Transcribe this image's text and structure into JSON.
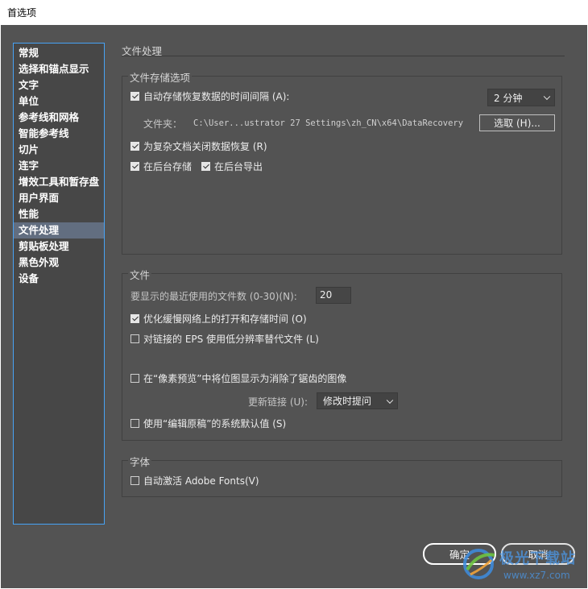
{
  "window": {
    "title": "首选项"
  },
  "sidebar": {
    "items": [
      {
        "label": "常规"
      },
      {
        "label": "选择和锚点显示"
      },
      {
        "label": "文字"
      },
      {
        "label": "单位"
      },
      {
        "label": "参考线和网格"
      },
      {
        "label": "智能参考线"
      },
      {
        "label": "切片"
      },
      {
        "label": "连字"
      },
      {
        "label": "增效工具和暂存盘"
      },
      {
        "label": "用户界面"
      },
      {
        "label": "性能"
      },
      {
        "label": "文件处理",
        "selected": true
      },
      {
        "label": "剪贴板处理"
      },
      {
        "label": "黑色外观"
      },
      {
        "label": "设备"
      }
    ]
  },
  "page": {
    "title": "文件处理"
  },
  "storage_group": {
    "title": "文件存储选项",
    "autosave_label": "自动存储恢复数据的时间间隔 (A):",
    "autosave_checked": true,
    "interval_value": "2 分钟",
    "folder_label": "文件夹：",
    "folder_path": "C:\\User...ustrator 27 Settings\\zh_CN\\x64\\DataRecovery",
    "choose_button": "选取 (H)...",
    "complex_label": "为复杂文档关闭数据恢复 (R)",
    "complex_checked": true,
    "bg_save_label": "在后台存储",
    "bg_save_checked": true,
    "bg_export_label": "在后台导出",
    "bg_export_checked": true
  },
  "files_group": {
    "title": "文件",
    "recent_label": "要显示的最近使用的文件数 (0-30)(N):",
    "recent_value": "20",
    "optimize_label": "优化缓慢网络上的打开和存储时间 (O)",
    "optimize_checked": true,
    "eps_label": "对链接的 EPS 使用低分辨率替代文件 (L)",
    "eps_checked": false,
    "pixel_preview_label": "在“像素预览”中将位图显示为消除了锯齿的图像",
    "pixel_preview_checked": false,
    "update_links_label": "更新链接 (U):",
    "update_links_value": "修改时提问",
    "edit_original_label": "使用“编辑原稿”的系统默认值 (S)",
    "edit_original_checked": false
  },
  "fonts_group": {
    "title": "字体",
    "auto_activate_label": "自动激活 Adobe Fonts(V)",
    "auto_activate_checked": false
  },
  "footer": {
    "ok_label": "确定",
    "cancel_label": "取消"
  },
  "watermark": {
    "site_name": "极光下载站",
    "url": "www.xz7.com"
  },
  "colors": {
    "dialog_bg": "#535353",
    "list_bg": "#474747",
    "list_border": "#47a3f5",
    "selected_bg": "#626e80"
  }
}
